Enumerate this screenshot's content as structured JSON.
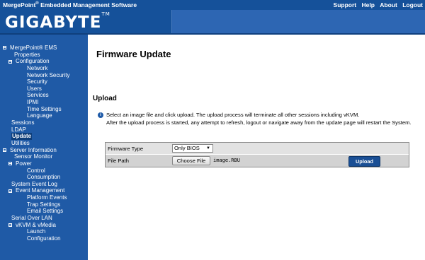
{
  "header": {
    "app_title": "MergePoint",
    "app_title_reg": "®",
    "app_title_rest": " Embedded Management Software",
    "links": [
      "Support",
      "Help",
      "About",
      "Logout"
    ],
    "logo": "GIGABYTE",
    "logo_tm": "TM"
  },
  "sidebar": {
    "items": [
      {
        "label": "MergePoint® EMS",
        "indent": 0,
        "toggle": true
      },
      {
        "label": "Properties",
        "indent": 1,
        "toggle": false
      },
      {
        "label": "Configuration",
        "indent": 1,
        "toggle": true
      },
      {
        "label": "Network",
        "indent": 2,
        "toggle": false
      },
      {
        "label": "Network Security",
        "indent": 2,
        "toggle": false
      },
      {
        "label": "Security",
        "indent": 2,
        "toggle": false
      },
      {
        "label": "Users",
        "indent": 2,
        "toggle": false
      },
      {
        "label": "Services",
        "indent": 2,
        "toggle": false
      },
      {
        "label": "IPMI",
        "indent": 2,
        "toggle": false
      },
      {
        "label": "Time Settings",
        "indent": 2,
        "toggle": false
      },
      {
        "label": "Language",
        "indent": 2,
        "toggle": false
      },
      {
        "label": "Sessions",
        "indent": 0,
        "toggle": false
      },
      {
        "label": "LDAP",
        "indent": 0,
        "toggle": false
      },
      {
        "label": "Update",
        "indent": 0,
        "toggle": false,
        "active": true
      },
      {
        "label": "Utilities",
        "indent": 0,
        "toggle": false
      },
      {
        "label": "Server Information",
        "indent": 0,
        "toggle": true
      },
      {
        "label": "Sensor Monitor",
        "indent": 1,
        "toggle": false
      },
      {
        "label": "Power",
        "indent": 1,
        "toggle": true
      },
      {
        "label": "Control",
        "indent": 2,
        "toggle": false
      },
      {
        "label": "Consumption",
        "indent": 2,
        "toggle": false
      },
      {
        "label": "System Event Log",
        "indent": 0,
        "toggle": false
      },
      {
        "label": "Event Management",
        "indent": 1,
        "toggle": true
      },
      {
        "label": "Platform Events",
        "indent": 2,
        "toggle": false
      },
      {
        "label": "Trap Settings",
        "indent": 2,
        "toggle": false
      },
      {
        "label": "Email Settings",
        "indent": 2,
        "toggle": false
      },
      {
        "label": "Serial Over LAN",
        "indent": 0,
        "toggle": false
      },
      {
        "label": "vKVM & vMedia",
        "indent": 1,
        "toggle": true
      },
      {
        "label": "Launch",
        "indent": 2,
        "toggle": false
      },
      {
        "label": "Configuration",
        "indent": 2,
        "toggle": false
      }
    ]
  },
  "main": {
    "page_title": "Firmware Update",
    "section_title": "Upload",
    "info_line1": "Select an image file and click upload. The upload process will terminate all other sessions including vKVM.",
    "info_line2": "After the upload process is started, any attempt to refresh, logout or navigate away from the update page will restart the System.",
    "form": {
      "firmware_type_label": "Firmware Type",
      "firmware_type_value": "Only BIOS",
      "file_path_label": "File Path",
      "choose_file_label": "Choose File",
      "file_name": "image.RBU",
      "upload_label": "Upload"
    }
  },
  "colors": {
    "header_blue": "#15519a",
    "sidebar_blue": "#1f5aa6",
    "upload_button": "#1a4f95"
  },
  "icons": {
    "info": "info-icon",
    "toggle": "collapse-toggle-icon",
    "dropdown": "chevron-down-icon"
  }
}
